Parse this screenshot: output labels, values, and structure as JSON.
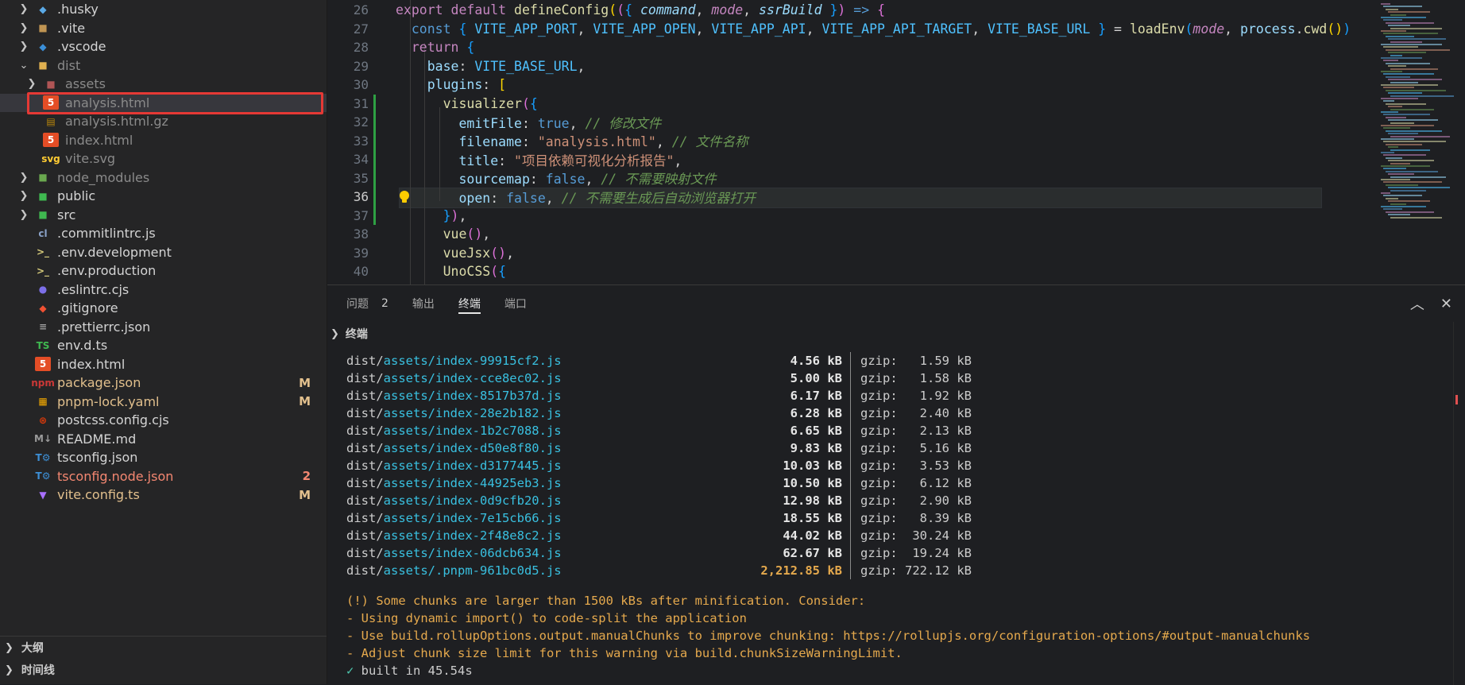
{
  "explorer": {
    "items": [
      {
        "name": ".husky",
        "kind": "folder",
        "expanded": false,
        "icon": "husky-folder-icon",
        "depth": 0
      },
      {
        "name": ".vite",
        "kind": "folder",
        "expanded": false,
        "icon": "folder-icon",
        "depth": 0
      },
      {
        "name": ".vscode",
        "kind": "folder",
        "expanded": false,
        "icon": "vscode-folder-icon",
        "depth": 0
      },
      {
        "name": "dist",
        "kind": "folder",
        "expanded": true,
        "icon": "dist-folder-icon",
        "depth": 0,
        "dim": true
      },
      {
        "name": "assets",
        "kind": "folder",
        "expanded": false,
        "icon": "assets-folder-icon",
        "depth": 1,
        "dim": true
      },
      {
        "name": "analysis.html",
        "kind": "file",
        "icon": "html-file-icon",
        "depth": 1,
        "dim": true,
        "highlighted": true
      },
      {
        "name": "analysis.html.gz",
        "kind": "file",
        "icon": "archive-file-icon",
        "depth": 1,
        "dim": true
      },
      {
        "name": "index.html",
        "kind": "file",
        "icon": "html-file-icon",
        "depth": 1,
        "dim": true
      },
      {
        "name": "vite.svg",
        "kind": "file",
        "icon": "svg-file-icon",
        "depth": 1,
        "dim": true
      },
      {
        "name": "node_modules",
        "kind": "folder",
        "expanded": false,
        "icon": "node-folder-icon",
        "depth": 0,
        "dim": true
      },
      {
        "name": "public",
        "kind": "folder",
        "expanded": false,
        "icon": "public-folder-icon",
        "depth": 0
      },
      {
        "name": "src",
        "kind": "folder",
        "expanded": false,
        "icon": "src-folder-icon",
        "depth": 0
      },
      {
        "name": ".commitlintrc.js",
        "kind": "file",
        "icon": "commitlint-file-icon",
        "depth": 0
      },
      {
        "name": ".env.development",
        "kind": "file",
        "icon": "env-file-icon",
        "depth": 0
      },
      {
        "name": ".env.production",
        "kind": "file",
        "icon": "env-file-icon",
        "depth": 0
      },
      {
        "name": ".eslintrc.cjs",
        "kind": "file",
        "icon": "eslint-file-icon",
        "depth": 0
      },
      {
        "name": ".gitignore",
        "kind": "file",
        "icon": "git-file-icon",
        "depth": 0
      },
      {
        "name": ".prettierrc.json",
        "kind": "file",
        "icon": "prettier-file-icon",
        "depth": 0
      },
      {
        "name": "env.d.ts",
        "kind": "file",
        "icon": "typescript-file-icon",
        "depth": 0
      },
      {
        "name": "index.html",
        "kind": "file",
        "icon": "html-file-icon",
        "depth": 0
      },
      {
        "name": "package.json",
        "kind": "file",
        "icon": "npm-file-icon",
        "depth": 0,
        "status": "mod",
        "badge": "M"
      },
      {
        "name": "pnpm-lock.yaml",
        "kind": "file",
        "icon": "pnpm-file-icon",
        "depth": 0,
        "status": "mod",
        "badge": "M"
      },
      {
        "name": "postcss.config.cjs",
        "kind": "file",
        "icon": "postcss-file-icon",
        "depth": 0
      },
      {
        "name": "README.md",
        "kind": "file",
        "icon": "markdown-file-icon",
        "depth": 0
      },
      {
        "name": "tsconfig.json",
        "kind": "file",
        "icon": "tsconfig-file-icon",
        "depth": 0
      },
      {
        "name": "tsconfig.node.json",
        "kind": "file",
        "icon": "tsconfig-file-icon",
        "depth": 0,
        "status": "err",
        "badge": "2"
      },
      {
        "name": "vite.config.ts",
        "kind": "file",
        "icon": "vite-file-icon",
        "depth": 0,
        "status": "mod",
        "badge": "M"
      }
    ],
    "bottom_sections": [
      "大纲",
      "时间线"
    ]
  },
  "editor": {
    "current_line": 36,
    "lines": [
      {
        "n": 26,
        "tokens": [
          [
            "kw",
            "export"
          ],
          [
            "pn",
            " "
          ],
          [
            "kw",
            "default"
          ],
          [
            "pn",
            " "
          ],
          [
            "fn",
            "defineConfig"
          ],
          [
            "br1",
            "("
          ],
          [
            "br2",
            "("
          ],
          [
            "br3",
            "{"
          ],
          [
            "pn",
            " "
          ],
          [
            "param",
            "command"
          ],
          [
            "pn",
            ", "
          ],
          [
            "param2",
            "mode"
          ],
          [
            "pn",
            ", "
          ],
          [
            "param",
            "ssrBuild"
          ],
          [
            "pn",
            " "
          ],
          [
            "br3",
            "}"
          ],
          [
            "br2",
            ")"
          ],
          [
            "pn",
            " "
          ],
          [
            "kw2",
            "=>"
          ],
          [
            "pn",
            " "
          ],
          [
            "br2",
            "{"
          ]
        ]
      },
      {
        "n": 27,
        "tokens": [
          [
            "pn",
            "  "
          ],
          [
            "kw2",
            "const"
          ],
          [
            "pn",
            " "
          ],
          [
            "br3",
            "{"
          ],
          [
            "pn",
            " "
          ],
          [
            "const",
            "VITE_APP_PORT"
          ],
          [
            "pn",
            ", "
          ],
          [
            "const",
            "VITE_APP_OPEN"
          ],
          [
            "pn",
            ", "
          ],
          [
            "const",
            "VITE_APP_API"
          ],
          [
            "pn",
            ", "
          ],
          [
            "const",
            "VITE_APP_API_TARGET"
          ],
          [
            "pn",
            ", "
          ],
          [
            "const",
            "VITE_BASE_URL"
          ],
          [
            "pn",
            " "
          ],
          [
            "br3",
            "}"
          ],
          [
            "pn",
            " = "
          ],
          [
            "fn",
            "loadEnv"
          ],
          [
            "br3",
            "("
          ],
          [
            "param2",
            "mode"
          ],
          [
            "pn",
            ", "
          ],
          [
            "var",
            "process"
          ],
          [
            "pn",
            "."
          ],
          [
            "fn",
            "cwd"
          ],
          [
            "br1",
            "()"
          ],
          [
            "br3",
            ")"
          ]
        ]
      },
      {
        "n": 28,
        "tokens": [
          [
            "pn",
            "  "
          ],
          [
            "kw",
            "return"
          ],
          [
            "pn",
            " "
          ],
          [
            "br3",
            "{"
          ]
        ]
      },
      {
        "n": 29,
        "tokens": [
          [
            "pn",
            "    "
          ],
          [
            "var",
            "base"
          ],
          [
            "pn",
            ": "
          ],
          [
            "const",
            "VITE_BASE_URL"
          ],
          [
            "pn",
            ","
          ]
        ]
      },
      {
        "n": 30,
        "tokens": [
          [
            "pn",
            "    "
          ],
          [
            "var",
            "plugins"
          ],
          [
            "pn",
            ": "
          ],
          [
            "br1",
            "["
          ]
        ]
      },
      {
        "n": 31,
        "tokens": [
          [
            "pn",
            "      "
          ],
          [
            "fn",
            "visualizer"
          ],
          [
            "br2",
            "("
          ],
          [
            "br3",
            "{"
          ]
        ]
      },
      {
        "n": 32,
        "tokens": [
          [
            "pn",
            "        "
          ],
          [
            "var",
            "emitFile"
          ],
          [
            "pn",
            ": "
          ],
          [
            "bool",
            "true"
          ],
          [
            "pn",
            ", "
          ],
          [
            "cm",
            "// 修改文件"
          ]
        ]
      },
      {
        "n": 33,
        "tokens": [
          [
            "pn",
            "        "
          ],
          [
            "var",
            "filename"
          ],
          [
            "pn",
            ": "
          ],
          [
            "str",
            "\"analysis.html\""
          ],
          [
            "pn",
            ", "
          ],
          [
            "cm",
            "// 文件名称"
          ]
        ]
      },
      {
        "n": 34,
        "tokens": [
          [
            "pn",
            "        "
          ],
          [
            "var",
            "title"
          ],
          [
            "pn",
            ": "
          ],
          [
            "str",
            "\"项目依赖可视化分析报告\""
          ],
          [
            "pn",
            ","
          ]
        ]
      },
      {
        "n": 35,
        "tokens": [
          [
            "pn",
            "        "
          ],
          [
            "var",
            "sourcemap"
          ],
          [
            "pn",
            ": "
          ],
          [
            "bool",
            "false"
          ],
          [
            "pn",
            ", "
          ],
          [
            "cm",
            "// 不需要映射文件"
          ]
        ]
      },
      {
        "n": 36,
        "tokens": [
          [
            "pn",
            "        "
          ],
          [
            "var",
            "open"
          ],
          [
            "pn",
            ": "
          ],
          [
            "bool",
            "false"
          ],
          [
            "pn",
            ", "
          ],
          [
            "cm",
            "// 不需要生成后自动浏览器打开"
          ]
        ]
      },
      {
        "n": 37,
        "tokens": [
          [
            "pn",
            "      "
          ],
          [
            "br3",
            "}"
          ],
          [
            "br2",
            ")"
          ],
          [
            "pn",
            ","
          ]
        ]
      },
      {
        "n": 38,
        "tokens": [
          [
            "pn",
            "      "
          ],
          [
            "fn",
            "vue"
          ],
          [
            "br2",
            "()"
          ],
          [
            "pn",
            ","
          ]
        ]
      },
      {
        "n": 39,
        "tokens": [
          [
            "pn",
            "      "
          ],
          [
            "fn",
            "vueJsx"
          ],
          [
            "br2",
            "()"
          ],
          [
            "pn",
            ","
          ]
        ]
      },
      {
        "n": 40,
        "tokens": [
          [
            "pn",
            "      "
          ],
          [
            "fn",
            "UnoCSS"
          ],
          [
            "br2",
            "("
          ],
          [
            "br3",
            "{"
          ]
        ]
      }
    ]
  },
  "panel": {
    "tabs": [
      {
        "label": "问题",
        "count": "2",
        "active": false
      },
      {
        "label": "输出",
        "active": false
      },
      {
        "label": "终端",
        "active": true
      },
      {
        "label": "端口",
        "active": false
      }
    ],
    "terminal_title": "终端",
    "files": [
      {
        "prefix": "dist/",
        "path": "assets/index-99915cf2.js",
        "size": "4.56 kB",
        "gzip": "gzip:   1.59 kB"
      },
      {
        "prefix": "dist/",
        "path": "assets/index-cce8ec02.js",
        "size": "5.00 kB",
        "gzip": "gzip:   1.58 kB"
      },
      {
        "prefix": "dist/",
        "path": "assets/index-8517b37d.js",
        "size": "6.17 kB",
        "gzip": "gzip:   1.92 kB"
      },
      {
        "prefix": "dist/",
        "path": "assets/index-28e2b182.js",
        "size": "6.28 kB",
        "gzip": "gzip:   2.40 kB"
      },
      {
        "prefix": "dist/",
        "path": "assets/index-1b2c7088.js",
        "size": "6.65 kB",
        "gzip": "gzip:   2.13 kB"
      },
      {
        "prefix": "dist/",
        "path": "assets/index-d50e8f80.js",
        "size": "9.83 kB",
        "gzip": "gzip:   5.16 kB"
      },
      {
        "prefix": "dist/",
        "path": "assets/index-d3177445.js",
        "size": "10.03 kB",
        "gzip": "gzip:   3.53 kB"
      },
      {
        "prefix": "dist/",
        "path": "assets/index-44925eb3.js",
        "size": "10.50 kB",
        "gzip": "gzip:   6.12 kB"
      },
      {
        "prefix": "dist/",
        "path": "assets/index-0d9cfb20.js",
        "size": "12.98 kB",
        "gzip": "gzip:   2.90 kB"
      },
      {
        "prefix": "dist/",
        "path": "assets/index-7e15cb66.js",
        "size": "18.55 kB",
        "gzip": "gzip:   8.39 kB"
      },
      {
        "prefix": "dist/",
        "path": "assets/index-2f48e8c2.js",
        "size": "44.02 kB",
        "gzip": "gzip:  30.24 kB"
      },
      {
        "prefix": "dist/",
        "path": "assets/index-06dcb634.js",
        "size": "62.67 kB",
        "gzip": "gzip:  19.24 kB"
      },
      {
        "prefix": "dist/",
        "path": "assets/.pnpm-961bc0d5.js",
        "size": "2,212.85 kB",
        "gzip": "gzip: 722.12 kB",
        "large": true
      }
    ],
    "warnings": [
      "(!) Some chunks are larger than 1500 kBs after minification. Consider:",
      "- Using dynamic import() to code-split the application",
      "- Use build.rollupOptions.output.manualChunks to improve chunking: https://rollupjs.org/configuration-options/#output-manualchunks",
      "- Adjust chunk size limit for this warning via build.chunkSizeWarningLimit."
    ],
    "success": {
      "mark": "✓",
      "text": " built in 45.54s"
    }
  },
  "colors": {
    "highlight_box": "#e53935",
    "modified": "#e2c08d",
    "error": "#f48771",
    "path_cyan": "#39c0e0",
    "warn": "#e5a94d"
  }
}
